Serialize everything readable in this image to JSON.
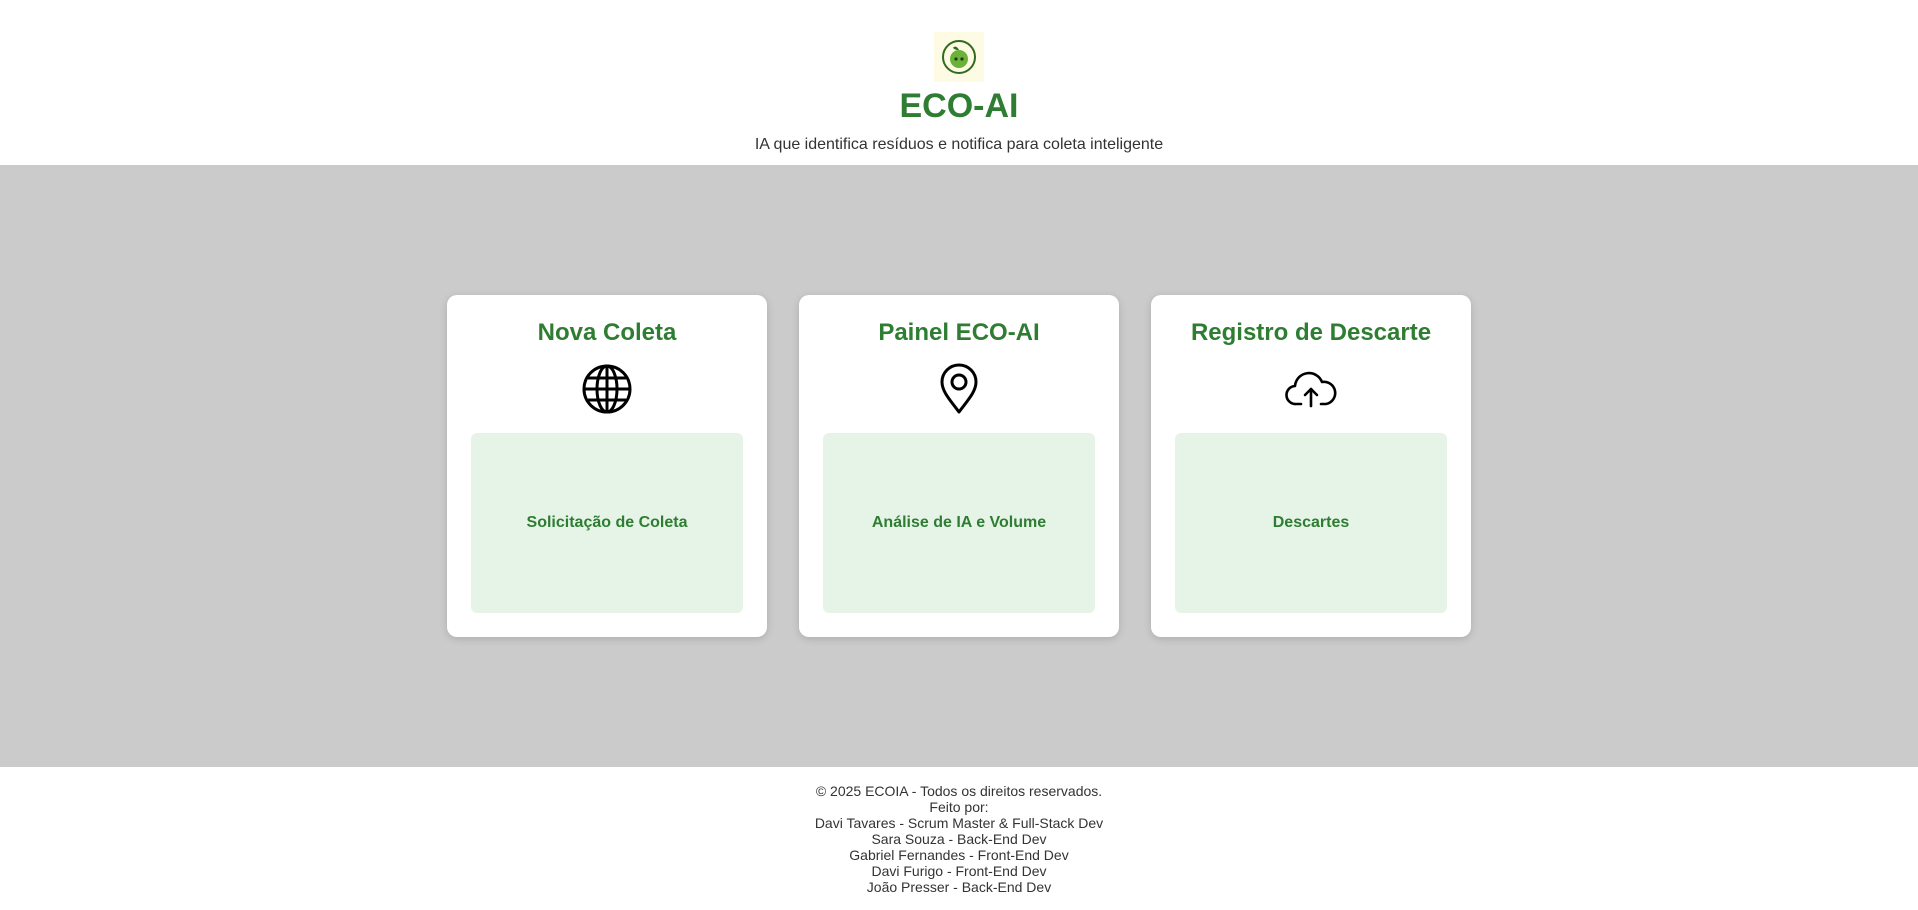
{
  "header": {
    "logo_icon": "apple-leaf-icon",
    "title": "ECO-AI",
    "tagline": "IA que identifica resíduos e notifica para coleta inteligente"
  },
  "cards": [
    {
      "title": "Nova Coleta",
      "icon": "globe-icon",
      "action_label": "Solicitação de Coleta"
    },
    {
      "title": "Painel ECO-AI",
      "icon": "map-pin-icon",
      "action_label": "Análise de IA e Volume"
    },
    {
      "title": "Registro de Descarte",
      "icon": "cloud-upload-icon",
      "action_label": "Descartes"
    }
  ],
  "footer": {
    "copyright": "© 2025 ECOIA - Todos os direitos reservados.",
    "made_by": "Feito por:",
    "credits": [
      "Davi Tavares - Scrum Master & Full-Stack Dev",
      "Sara Souza - Back-End Dev",
      "Gabriel Fernandes - Front-End Dev",
      "Davi Furigo - Front-End Dev",
      "João Presser - Back-End Dev"
    ]
  },
  "colors": {
    "brand": "#2e7d32",
    "card_action_bg": "#e6f4e8",
    "main_bg": "#cbcbcb"
  }
}
